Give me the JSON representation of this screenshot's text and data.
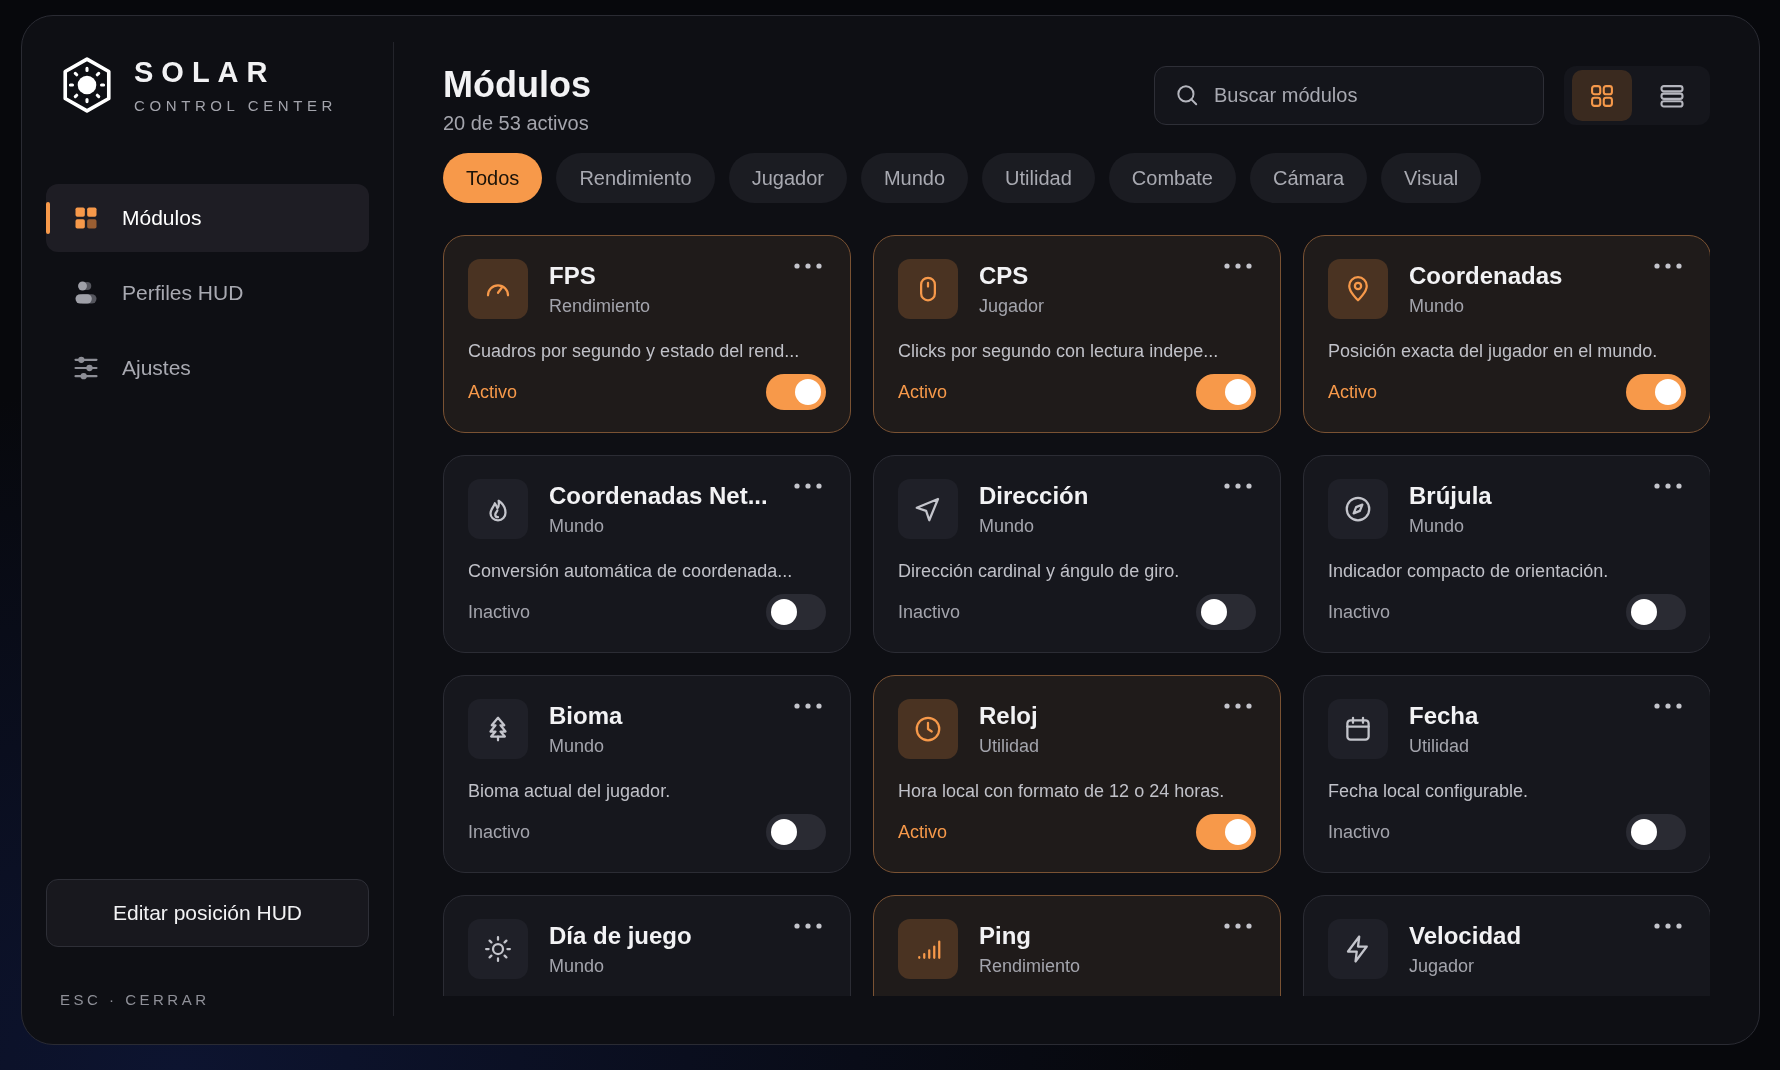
{
  "brand": {
    "name": "SOLAR",
    "tagline": "CONTROL CENTER"
  },
  "sidebar": {
    "items": [
      {
        "label": "Módulos",
        "selected": true
      },
      {
        "label": "Perfiles HUD",
        "selected": false
      },
      {
        "label": "Ajustes",
        "selected": false
      }
    ],
    "edit_button": "Editar posición HUD",
    "footer_hint": "ESC · CERRAR"
  },
  "header": {
    "title": "Módulos",
    "subtitle": "20 de 53 activos"
  },
  "search": {
    "placeholder": "Buscar módulos"
  },
  "view_toggle": [
    {
      "selected": true
    },
    {
      "selected": false
    }
  ],
  "filters": [
    {
      "label": "Todos",
      "selected": true
    },
    {
      "label": "Rendimiento",
      "selected": false
    },
    {
      "label": "Jugador",
      "selected": false
    },
    {
      "label": "Mundo",
      "selected": false
    },
    {
      "label": "Utilidad",
      "selected": false
    },
    {
      "label": "Combate",
      "selected": false
    },
    {
      "label": "Cámara",
      "selected": false
    },
    {
      "label": "Visual",
      "selected": false
    }
  ],
  "modules": [
    {
      "title": "FPS",
      "category": "Rendimiento",
      "description": "Cuadros por segundo y estado del rend...",
      "status": "Activo",
      "on": true
    },
    {
      "title": "CPS",
      "category": "Jugador",
      "description": "Clicks por segundo con lectura indepe...",
      "status": "Activo",
      "on": true
    },
    {
      "title": "Coordenadas",
      "category": "Mundo",
      "description": "Posición exacta del jugador en el mundo.",
      "status": "Activo",
      "on": true
    },
    {
      "title": "Coordenadas Net...",
      "category": "Mundo",
      "description": "Conversión automática de coordenada...",
      "status": "Inactivo",
      "on": false
    },
    {
      "title": "Dirección",
      "category": "Mundo",
      "description": "Dirección cardinal y ángulo de giro.",
      "status": "Inactivo",
      "on": false
    },
    {
      "title": "Brújula",
      "category": "Mundo",
      "description": "Indicador compacto de orientación.",
      "status": "Inactivo",
      "on": false
    },
    {
      "title": "Bioma",
      "category": "Mundo",
      "description": "Bioma actual del jugador.",
      "status": "Inactivo",
      "on": false
    },
    {
      "title": "Reloj",
      "category": "Utilidad",
      "description": "Hora local con formato de 12 o 24 horas.",
      "status": "Activo",
      "on": true
    },
    {
      "title": "Fecha",
      "category": "Utilidad",
      "description": "Fecha local configurable.",
      "status": "Inactivo",
      "on": false
    },
    {
      "title": "Día de juego",
      "category": "Mundo",
      "on": false
    },
    {
      "title": "Ping",
      "category": "Rendimiento",
      "on": true
    },
    {
      "title": "Velocidad",
      "category": "Jugador",
      "on": false
    }
  ]
}
